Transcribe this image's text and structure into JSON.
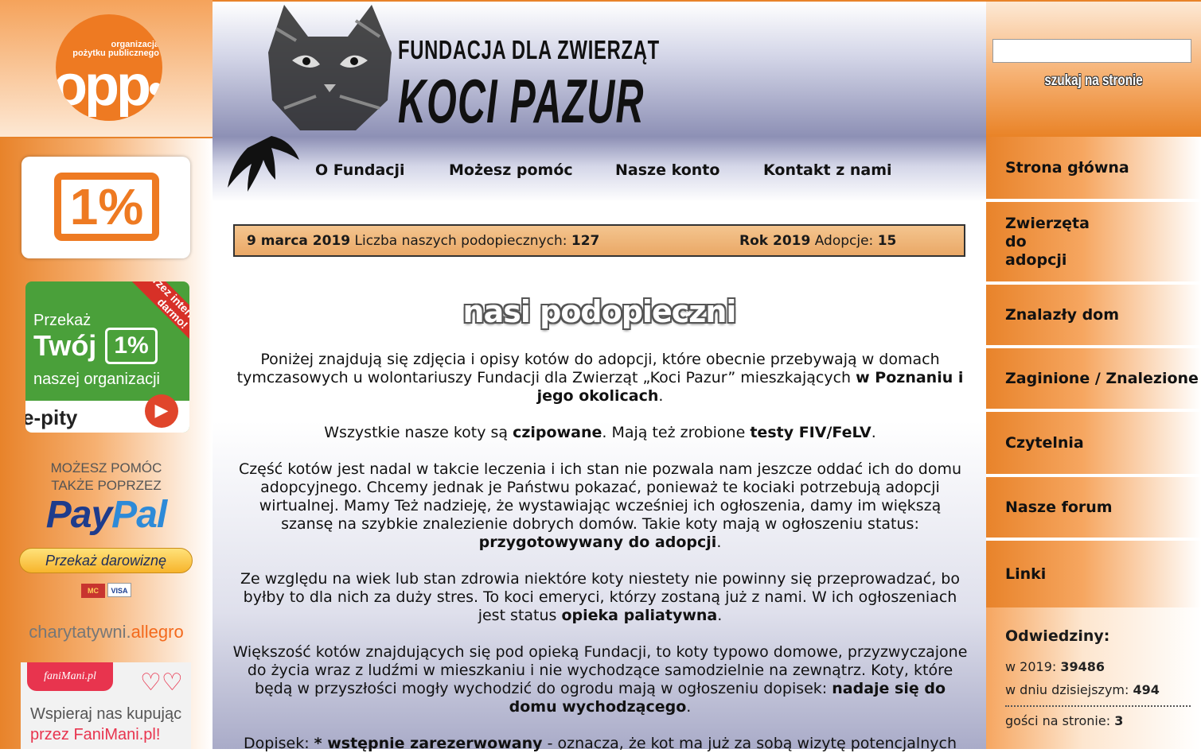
{
  "left": {
    "opp": {
      "small_line1": "organizacja",
      "small_line2": "pożytku publicznego",
      "big": "opp"
    },
    "onepct": "1%",
    "epity": {
      "ribbon": "przez internet za darmo!",
      "line1": "Przekaż",
      "line2": "Twój",
      "pct": "1%",
      "line3": "naszej organizacji",
      "logo": "e-pity",
      "arrow": "▶"
    },
    "paypal": {
      "text_line1": "MOŻESZ POMÓC",
      "text_line2": "TAKŻE POPRZEZ",
      "logo_a": "Pay",
      "logo_b": "Pal",
      "button": "Przekaż darowiznę",
      "card1": "MC",
      "card2": "VISA"
    },
    "allegro": {
      "a": "charytatywni.",
      "b": "allegro"
    },
    "fanimani": {
      "badge": "faniMani.pl",
      "heart": "♡♡",
      "line1": "Wspieraj nas kupując",
      "line2": "przez FaniMani.pl!"
    }
  },
  "header": {
    "title1": "FUNDACJA DLA ZWIERZĄT",
    "title2": "KOCI PAZUR"
  },
  "nav": [
    "O Fundacji",
    "Możesz pomóc",
    "Nasze konto",
    "Kontakt z nami"
  ],
  "info": {
    "date": "9 marca 2019",
    "count_label": "Liczba naszych podopiecznych:",
    "count": "127",
    "year": "Rok 2019",
    "adopt_label": "Adopcje:",
    "adopt": "15"
  },
  "main": {
    "heading": "nasi podopieczni",
    "p1a": "Poniżej znajdują się zdjęcia i opisy kotów do adopcji, które obecnie przebywają w domach tymczasowych u wolontariuszy Fundacji dla Zwierząt „Koci Pazur” mieszkających ",
    "p1b": "w Poznaniu i jego okolicach",
    "p1c": ".",
    "p2a": "Wszystkie nasze koty są ",
    "p2b": "czipowane",
    "p2c": ". Mają też zrobione ",
    "p2d": "testy FIV/FeLV",
    "p2e": ".",
    "p3a": "Część kotów jest nadal w takcie leczenia i ich stan nie pozwala nam jeszcze oddać ich do domu adopcyjnego. Chcemy jednak je Państwu pokazać, ponieważ te kociaki potrzebują adopcji wirtualnej. Mamy Też nadzieję, że wystawiając wcześniej ich ogłoszenia, damy im większą szansę na szybkie znalezienie dobrych domów. Takie koty mają w ogłoszeniu status: ",
    "p3b": "przygotowywany do adopcji",
    "p3c": ".",
    "p4a": "Ze względu na wiek lub stan zdrowia niektóre koty niestety nie powinny się przeprowadzać, bo byłby to dla nich za duży stres. To koci emeryci, którzy zostaną już z nami. W ich ogłoszeniach jest status ",
    "p4b": "opieka paliatywna",
    "p4c": ".",
    "p5a": "Większość kotów znajdujących się pod opieką Fundacji, to koty typowo domowe, przyzwyczajone do życia wraz z ludźmi w mieszkaniu i nie wychodzące samodzielnie na zewnątrz. Koty, które będą w przyszłości mogły wychodzić do ogrodu mają w ogłoszeniu dopisek: ",
    "p5b": "nadaje się do domu wychodzącego",
    "p5c": ".",
    "p6a": "Dopisek: ",
    "p6b": "* wstępnie zarezerwowany",
    "p6c": " - oznacza, że kot ma już za sobą wizytę potencjalnych"
  },
  "search": {
    "placeholder": "",
    "button": "szukaj na stronie"
  },
  "menu": [
    "Strona główna",
    "Zwierzęta do adopcji",
    "Znalazły dom",
    "Zaginione / Znalezione",
    "Czytelnia",
    "Nasze forum",
    "Linki"
  ],
  "visits": {
    "title": "Odwiedziny:",
    "year_label": "w 2019:",
    "year_value": "39486",
    "today_label": "w dniu dzisiejszym:",
    "today_value": "494",
    "guests_label": "gości na stronie:",
    "guests_value": "3"
  },
  "colors": {
    "orange": "#e8832a",
    "light_orange": "#f6b071",
    "info_box": "#f4c58f",
    "header_blue": "#8d90b5"
  }
}
